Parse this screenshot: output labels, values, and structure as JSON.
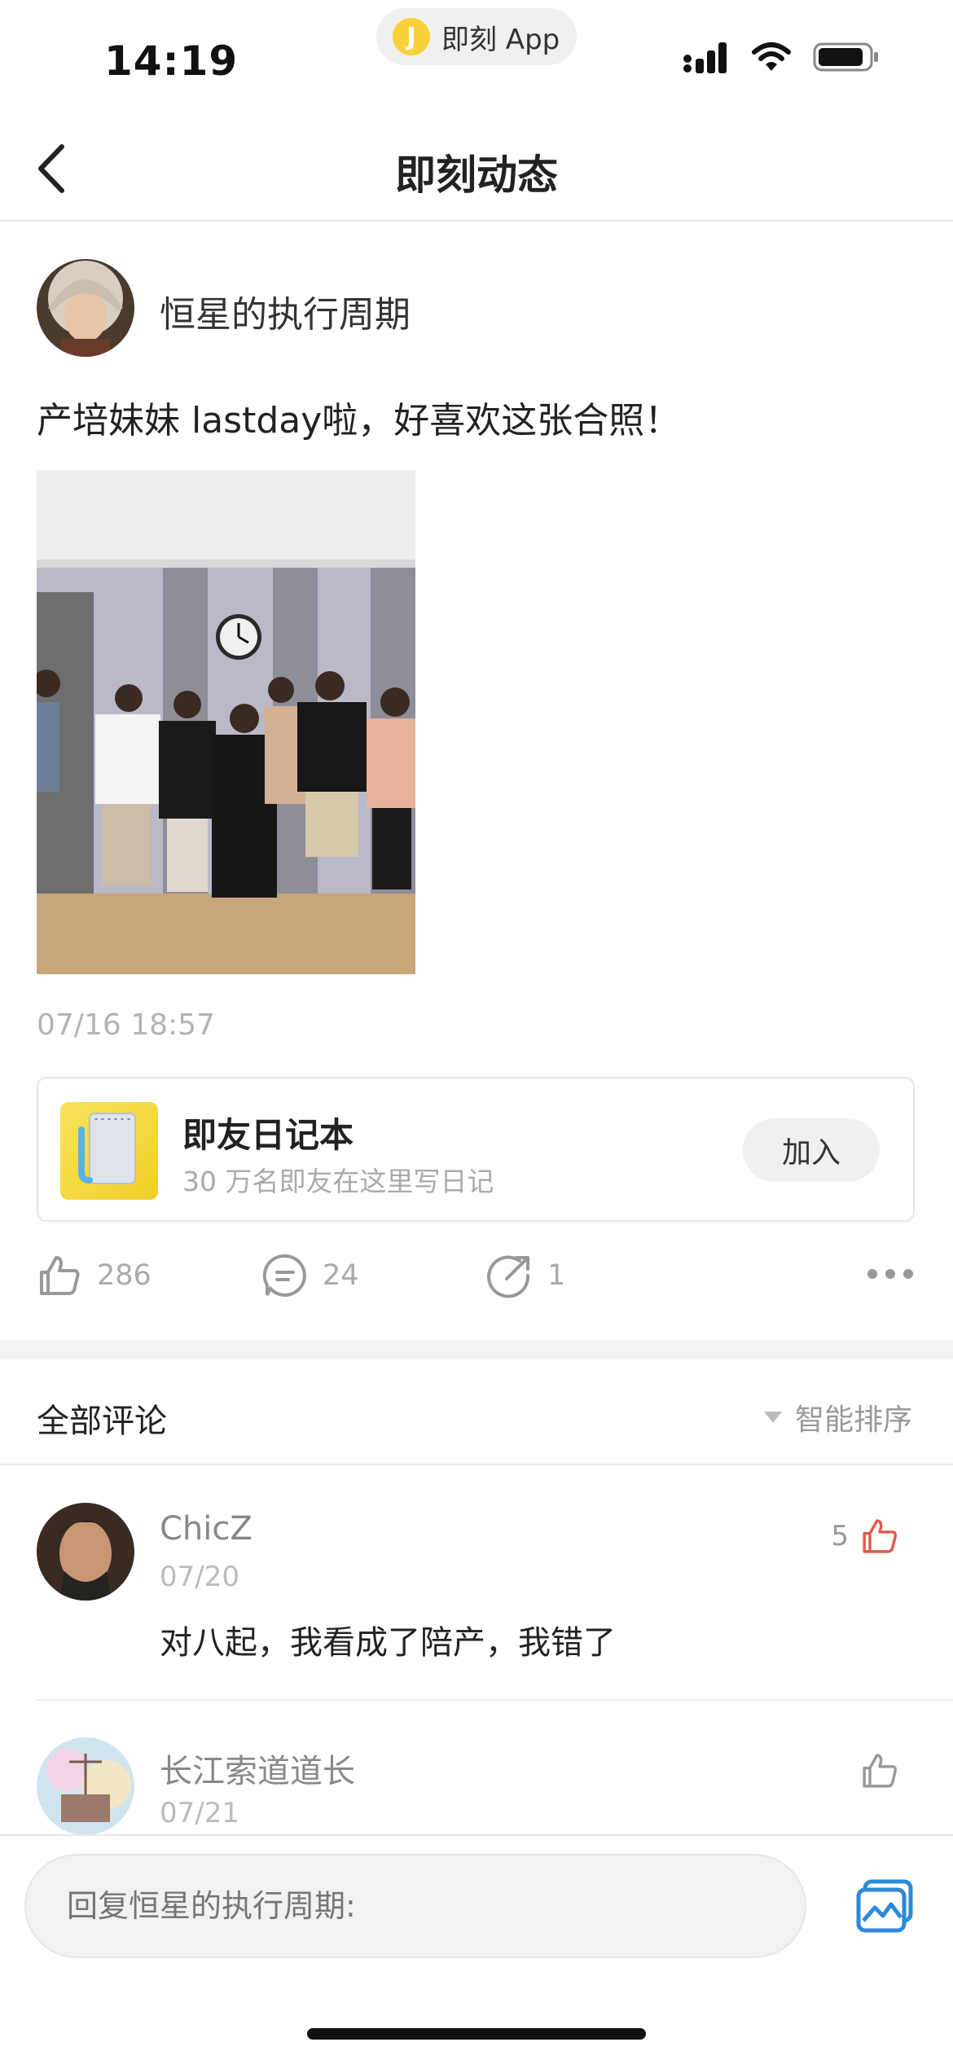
{
  "status_bar": {
    "time": "14:19",
    "pill_text": "即刻 App",
    "pill_logo_glyph": "J"
  },
  "nav": {
    "title": "即刻动态"
  },
  "post": {
    "author": "恒星的执行周期",
    "text": "产培妹妹 lastday啦，好喜欢这张合照！",
    "timestamp": "07/16 18:57",
    "topic_card": {
      "title": "即友日记本",
      "subtitle": "30 万名即友在这里写日记",
      "join_label": "加入"
    },
    "likes": "286",
    "comments": "24",
    "shares": "1"
  },
  "comments_section": {
    "title": "全部评论",
    "sort_label": "智能排序",
    "items": [
      {
        "name": "ChicZ",
        "date": "07/20",
        "text": "对八起，我看成了陪产，我错了",
        "likes": "5"
      },
      {
        "name": "长江索道道长",
        "date": "07/21",
        "text": "",
        "likes": ""
      }
    ]
  },
  "reply_bar": {
    "placeholder": "回复恒星的执行周期:"
  },
  "colors": {
    "accent_like": "#e05a4a",
    "image_button": "#2a8ad8",
    "logo_yellow": "#f7d13c"
  },
  "icons": [
    "back-chevron-icon",
    "signal-icon",
    "wifi-icon",
    "battery-icon",
    "like-icon",
    "comment-icon",
    "share-icon",
    "more-icon",
    "sort-triangle-icon",
    "image-picker-icon"
  ]
}
